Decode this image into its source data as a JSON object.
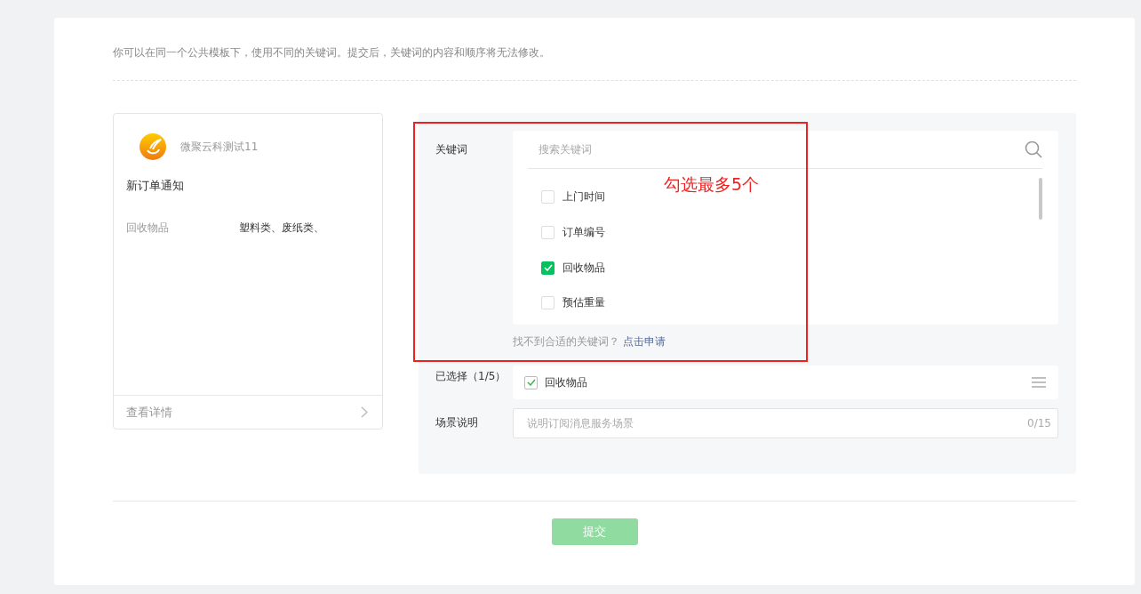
{
  "notice": "你可以在同一个公共模板下，使用不同的关键词。提交后，关键词的内容和顺序将无法修改。",
  "preview": {
    "account_name": "微聚云科测试11",
    "title": "新订单通知",
    "fields": [
      {
        "label": "回收物品",
        "value": "塑料类、废纸类、"
      }
    ],
    "details_link": "查看详情"
  },
  "keywords": {
    "label": "关键词",
    "search": {
      "placeholder": "搜索关键词"
    },
    "items": [
      {
        "label": "上门时间",
        "checked": false
      },
      {
        "label": "订单编号",
        "checked": false
      },
      {
        "label": "回收物品",
        "checked": true
      },
      {
        "label": "预估重量",
        "checked": false
      }
    ],
    "hint": "找不到合适的关键词？",
    "apply_link": "点击申请"
  },
  "selected": {
    "label": "已选择（1/5）",
    "items": [
      {
        "label": "回收物品",
        "checked": true
      }
    ]
  },
  "scene": {
    "label": "场景说明",
    "placeholder": "说明订阅消息服务场景",
    "counter": "0/15"
  },
  "submit": {
    "label": "提交",
    "disabled": true
  },
  "annotation": {
    "text": "勾选最多5个"
  }
}
